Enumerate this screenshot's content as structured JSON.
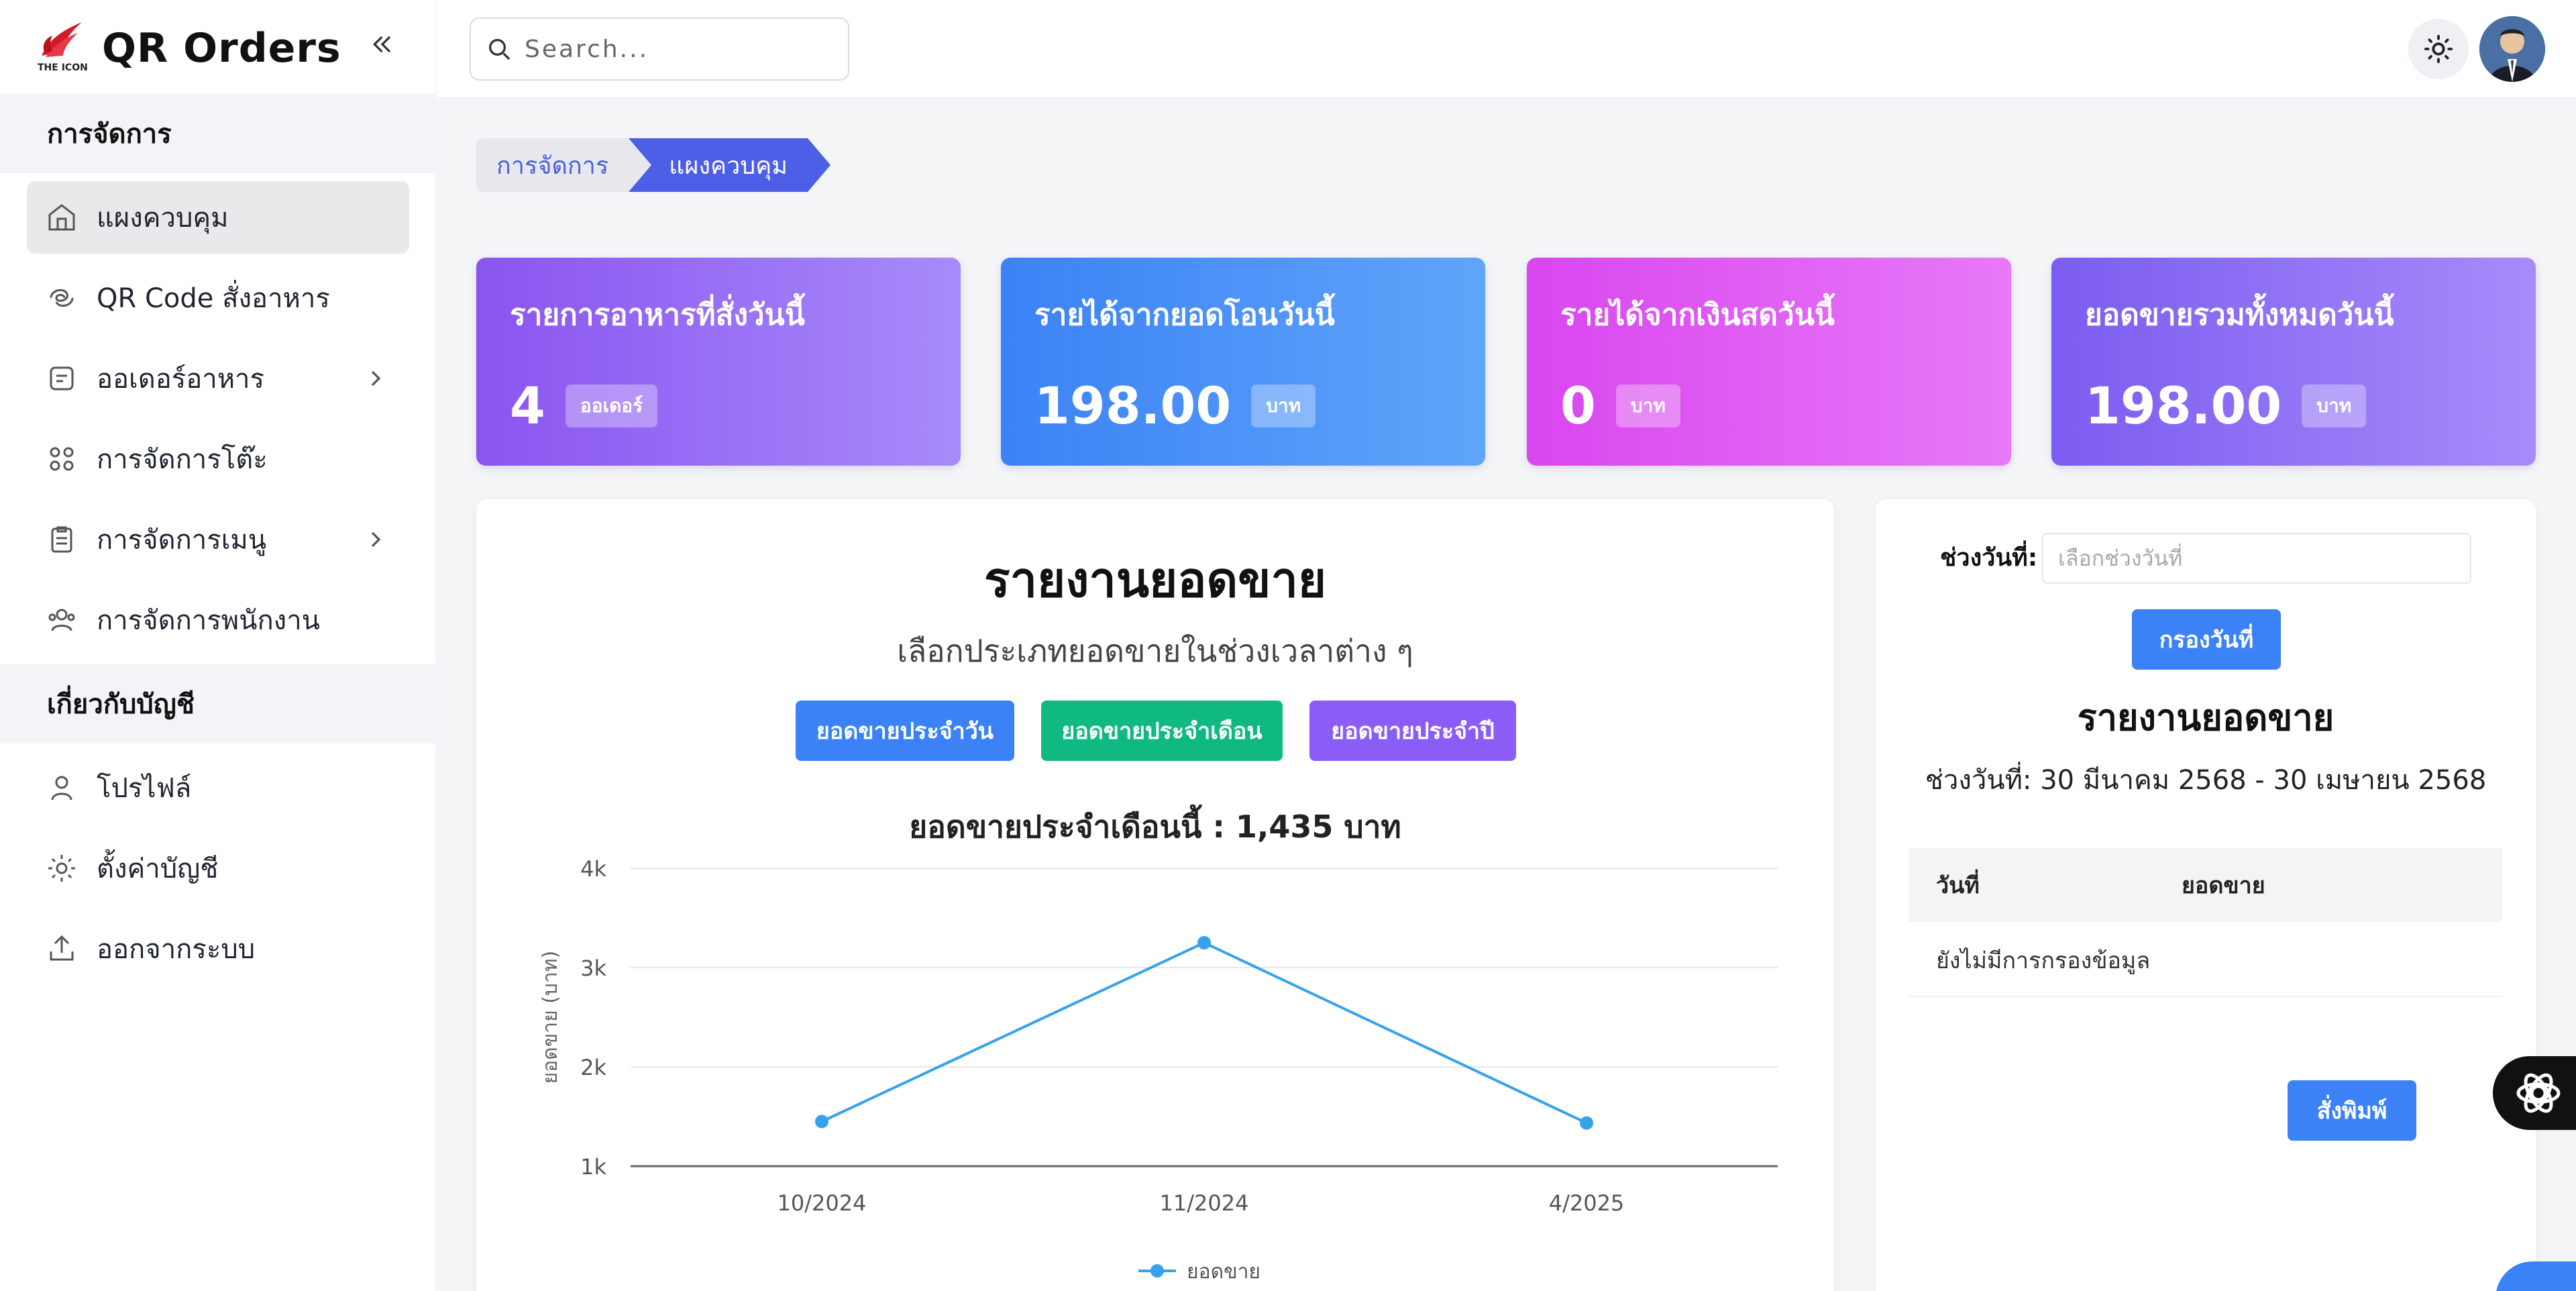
{
  "app": {
    "title": "QR Orders",
    "logo_text": "THE ICON"
  },
  "sidebar": {
    "sections": [
      {
        "label": "การจัดการ"
      },
      {
        "label": "เกี่ยวกับบัญชี"
      }
    ],
    "items": [
      {
        "label": "แผงควบคุม",
        "icon": "home-icon",
        "active": true
      },
      {
        "label": "QR Code สั่งอาหาร",
        "icon": "qr-swirl-icon"
      },
      {
        "label": "ออเดอร์อาหาร",
        "icon": "order-list-icon",
        "has_submenu": true
      },
      {
        "label": "การจัดการโต๊ะ",
        "icon": "grid-icon"
      },
      {
        "label": "การจัดการเมนู",
        "icon": "clipboard-icon",
        "has_submenu": true
      },
      {
        "label": "การจัดการพนักงาน",
        "icon": "users-icon"
      },
      {
        "label": "โปรไฟล์",
        "icon": "user-icon"
      },
      {
        "label": "ตั้งค่าบัญชี",
        "icon": "gear-icon"
      },
      {
        "label": "ออกจากระบบ",
        "icon": "logout-icon"
      }
    ]
  },
  "search": {
    "placeholder": "Search...",
    "value": ""
  },
  "breadcrumb": {
    "parent": "การจัดการ",
    "current": "แผงควบคุม"
  },
  "stats": [
    {
      "title": "รายการอาหารที่สั่งวันนี้",
      "value": "4",
      "unit": "ออเดอร์"
    },
    {
      "title": "รายได้จากยอดโอนวันนี้",
      "value": "198.00",
      "unit": "บาท"
    },
    {
      "title": "รายได้จากเงินสดวันนี้",
      "value": "0",
      "unit": "บาท"
    },
    {
      "title": "ยอดขายรวมทั้งหมดวันนี้",
      "value": "198.00",
      "unit": "บาท"
    }
  ],
  "report": {
    "title": "รายงานยอดขาย",
    "subtitle": "เลือกประเภทยอดขายในช่วงเวลาต่าง ๆ",
    "btn_day": "ยอดขายประจำวัน",
    "btn_month": "ยอดขายประจำเดือน",
    "btn_year": "ยอดขายประจำปี",
    "chart_heading": "ยอดขายประจำเดือนนี้ : 1,435 บาท"
  },
  "chart_data": {
    "type": "line",
    "title": "ยอดขายประจำเดือนนี้ : 1,435 บาท",
    "xlabel": "",
    "ylabel": "ยอดขาย (บาท)",
    "categories": [
      "10/2024",
      "11/2024",
      "4/2025"
    ],
    "series": [
      {
        "name": "ยอดขาย",
        "values": [
          1450,
          3250,
          1435
        ],
        "color": "#36a2eb"
      }
    ],
    "ylim": [
      1000,
      4000
    ],
    "yticks": [
      "1k",
      "2k",
      "3k",
      "4k"
    ],
    "grid": true,
    "legend": "bottom"
  },
  "filter": {
    "label": "ช่วงวันที่:",
    "placeholder": "เลือกช่วงวันที่",
    "btn": "กรองวันที่",
    "title": "รายงานยอดขาย",
    "range": "ช่วงวันที่: 30 มีนาคม 2568 - 30 เมษายน 2568",
    "col_date": "วันที่",
    "col_sales": "ยอดขาย",
    "empty": "ยังไม่มีการกรองข้อมูล",
    "print_btn": "สั่งพิมพ์"
  },
  "colors": {
    "accent": "#3b82f6",
    "line": "#36a2eb",
    "crumb": "#4d5fe6"
  }
}
